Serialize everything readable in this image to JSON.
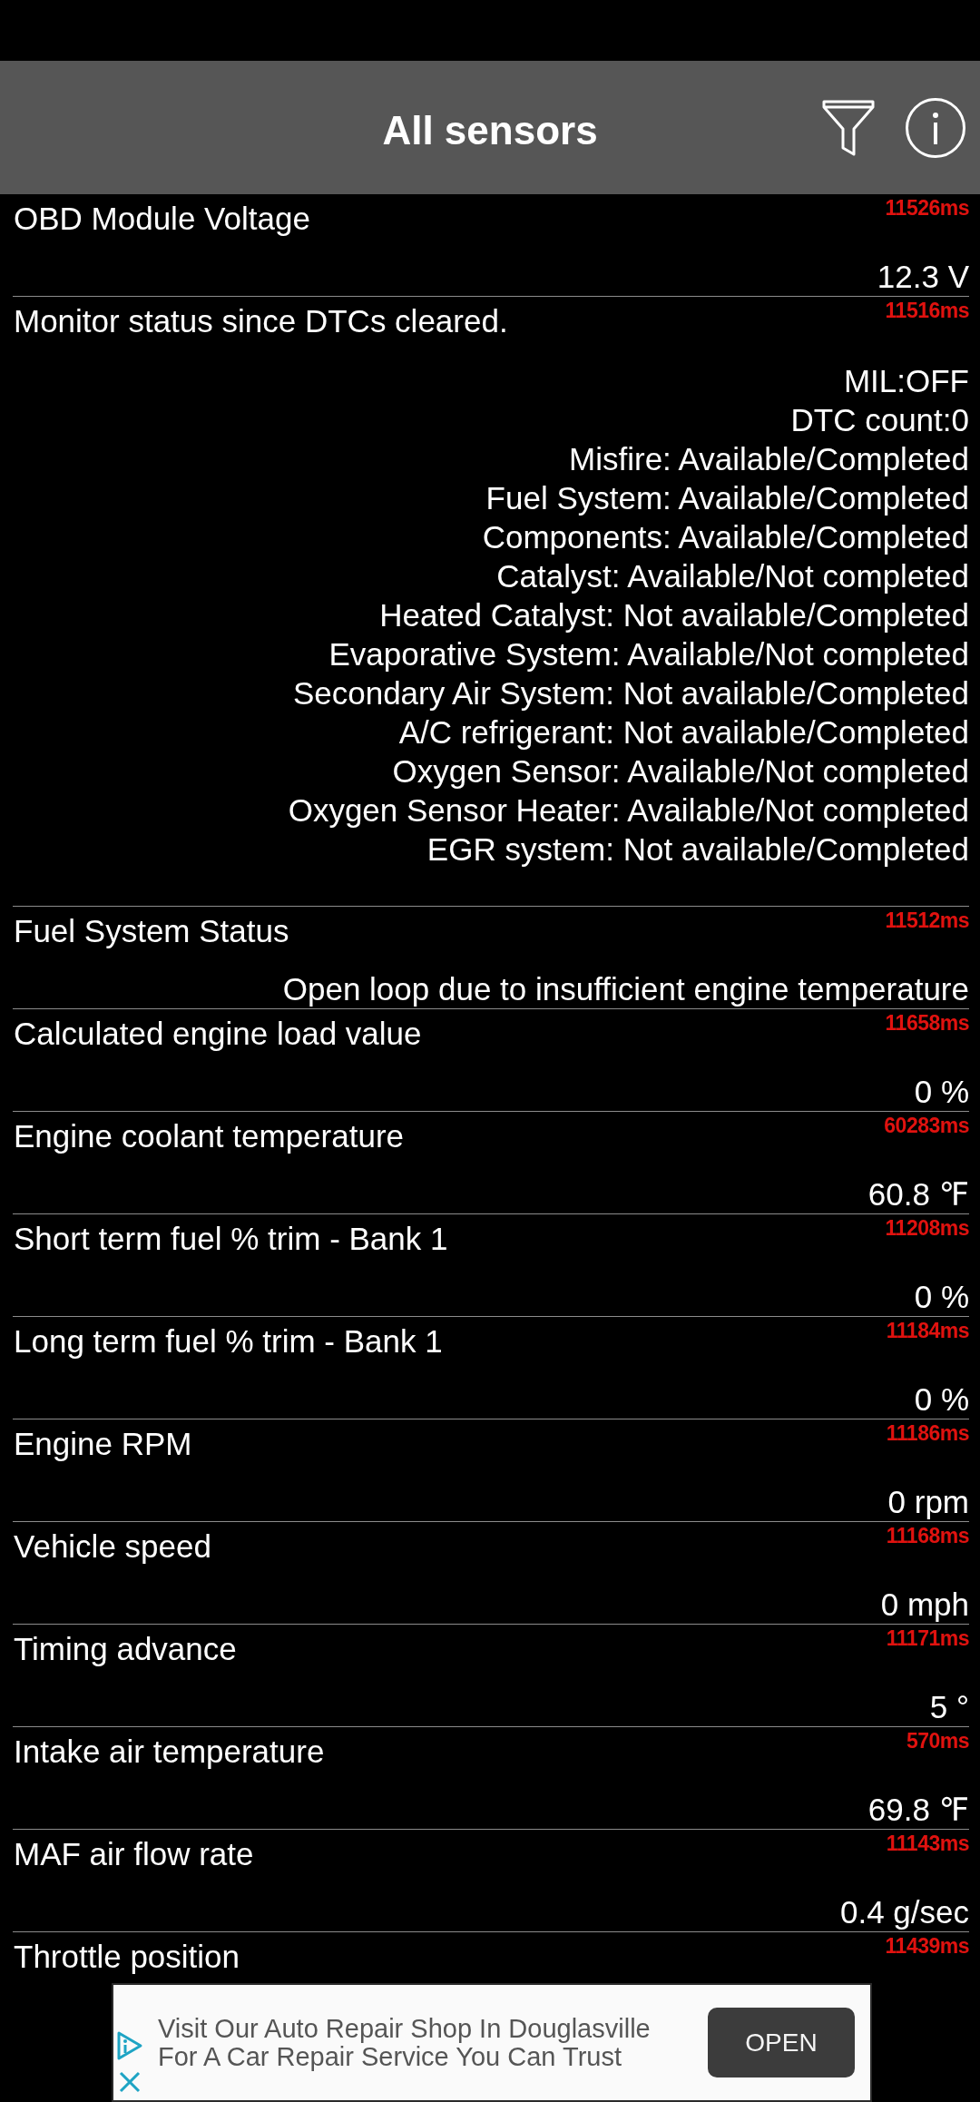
{
  "app_bar": {
    "title": "All sensors"
  },
  "sensors": [
    {
      "kind": "single",
      "name": "OBD Module Voltage",
      "elapsed": "11526ms",
      "value": "12.3 V"
    },
    {
      "kind": "list",
      "name": "Monitor status since DTCs cleared.",
      "elapsed": "11516ms",
      "lines": [
        "MIL:OFF",
        "DTC count:0",
        "Misfire: Available/Completed",
        "Fuel System: Available/Completed",
        "Components: Available/Completed",
        "Catalyst: Available/Not completed",
        "Heated Catalyst: Not available/Completed",
        "Evaporative System: Available/Not completed",
        "Secondary Air System: Not available/Completed",
        "A/C refrigerant: Not available/Completed",
        "Oxygen Sensor: Available/Not completed",
        "Oxygen Sensor Heater: Available/Not completed",
        "EGR system: Not available/Completed"
      ]
    },
    {
      "kind": "single",
      "name": "Fuel System Status",
      "elapsed": "11512ms",
      "value": "Open loop due to insufficient engine temperature"
    },
    {
      "kind": "single",
      "name": "Calculated engine load value",
      "elapsed": "11658ms",
      "value": "0 %"
    },
    {
      "kind": "single",
      "name": "Engine coolant temperature",
      "elapsed": "60283ms",
      "value": "60.8 ℉"
    },
    {
      "kind": "single",
      "name": "Short term fuel % trim - Bank 1",
      "elapsed": "11208ms",
      "value": "0 %"
    },
    {
      "kind": "single",
      "name": "Long term fuel % trim - Bank 1",
      "elapsed": "11184ms",
      "value": "0 %"
    },
    {
      "kind": "single",
      "name": "Engine RPM",
      "elapsed": "11186ms",
      "value": "0 rpm"
    },
    {
      "kind": "single",
      "name": "Vehicle speed",
      "elapsed": "11168ms",
      "value": "0 mph"
    },
    {
      "kind": "single",
      "name": "Timing advance",
      "elapsed": "11171ms",
      "value": "5 °"
    },
    {
      "kind": "single",
      "name": "Intake air temperature",
      "elapsed": "570ms",
      "value": "69.8 ℉"
    },
    {
      "kind": "single",
      "name": "MAF air flow rate",
      "elapsed": "11143ms",
      "value": "0.4 g/sec"
    },
    {
      "kind": "single",
      "name": "Throttle position",
      "elapsed": "11439ms"
    }
  ],
  "ad": {
    "text": "Visit Our Auto Repair Shop In Douglasville For A Car Repair Service You Can Trust",
    "button": "OPEN"
  }
}
